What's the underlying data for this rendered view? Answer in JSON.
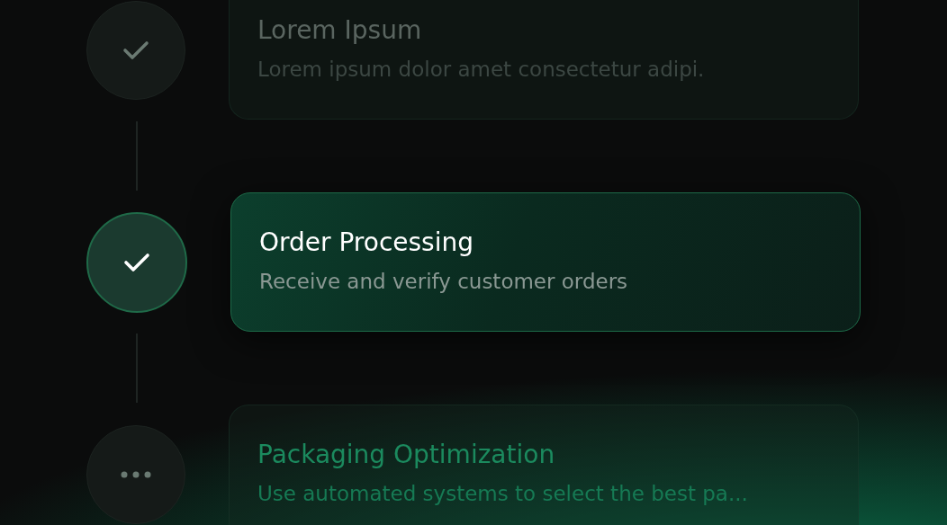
{
  "steps": [
    {
      "title": "Lorem Ipsum",
      "description": "Lorem ipsum dolor amet consectetur adipi.",
      "kind": "done",
      "active": false
    },
    {
      "title": "Order Processing",
      "description": "Receive and verify customer orders",
      "kind": "done",
      "active": true
    },
    {
      "title": "Packaging Optimization",
      "description": "Use automated systems to select the best pa...",
      "kind": "pending",
      "active": false
    }
  ]
}
